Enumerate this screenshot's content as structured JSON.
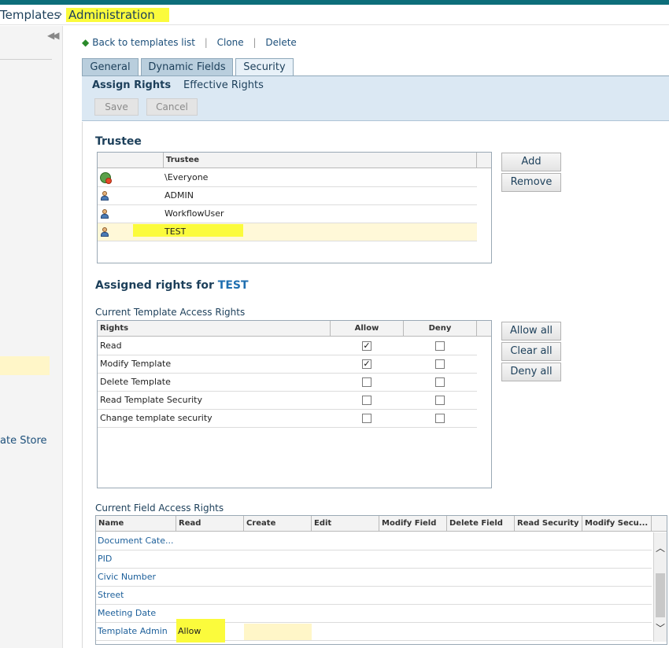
{
  "breadcrumb": {
    "parent": "Templates",
    "current": "Administration"
  },
  "leftpane": {
    "store_label": "ate Store"
  },
  "actions": {
    "back": "Back to templates list",
    "clone": "Clone",
    "delete": "Delete",
    "separator": "|"
  },
  "tabs": [
    "General",
    "Dynamic Fields",
    "Security"
  ],
  "subtabs": [
    "Assign Rights",
    "Effective Rights"
  ],
  "toolbar": {
    "save": "Save",
    "cancel": "Cancel"
  },
  "trustee": {
    "heading": "Trustee",
    "column": "Trustee",
    "rows": [
      {
        "name": "\\Everyone",
        "icon": "group-icon"
      },
      {
        "name": "ADMIN",
        "icon": "user-icon"
      },
      {
        "name": "WorkflowUser",
        "icon": "user-icon"
      },
      {
        "name": "TEST",
        "icon": "user-icon",
        "selected": true
      }
    ],
    "add": "Add",
    "remove": "Remove"
  },
  "assigned": {
    "prefix": "Assigned rights for",
    "name": "TEST"
  },
  "template_rights": {
    "heading": "Current Template Access Rights",
    "columns": [
      "Rights",
      "Allow",
      "Deny"
    ],
    "rows": [
      {
        "name": "Read",
        "allow": true,
        "deny": false
      },
      {
        "name": "Modify Template",
        "allow": true,
        "deny": false
      },
      {
        "name": "Delete Template",
        "allow": false,
        "deny": false
      },
      {
        "name": "Read Template Security",
        "allow": false,
        "deny": false
      },
      {
        "name": "Change template security",
        "allow": false,
        "deny": false
      }
    ],
    "allow_all": "Allow all",
    "clear_all": "Clear all",
    "deny_all": "Deny all"
  },
  "field_rights": {
    "heading": "Current Field Access Rights",
    "columns": [
      "Name",
      "Read",
      "Create",
      "Edit",
      "Modify Field",
      "Delete Field",
      "Read Security",
      "Modify Secu..."
    ],
    "rows": [
      {
        "name": "Document Cate...",
        "read": ""
      },
      {
        "name": "PID",
        "read": ""
      },
      {
        "name": "Civic Number",
        "read": ""
      },
      {
        "name": "Street",
        "read": ""
      },
      {
        "name": "Meeting Date",
        "read": ""
      },
      {
        "name": "Template Admin",
        "read": "Allow"
      }
    ]
  },
  "glyphs": {
    "check": "✓",
    "collapse": "◀◀",
    "chevron_right": "›",
    "back_arrow": "◆",
    "up": "︿",
    "down": "﹀"
  },
  "colors": {
    "accent": "#0d6e7a",
    "highlight": "#fbfb3c",
    "selected_row": "#fff8d8"
  }
}
